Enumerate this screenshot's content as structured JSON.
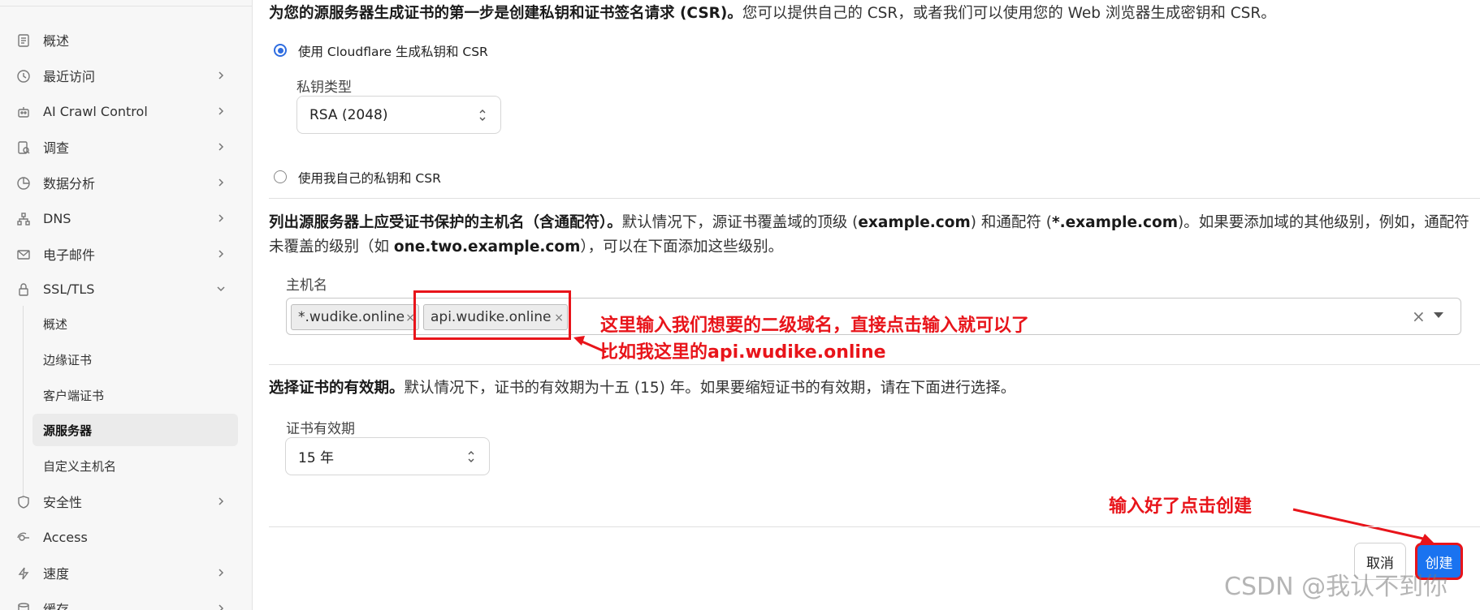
{
  "sidebar": {
    "items": [
      {
        "label": "概述",
        "icon": "document-icon",
        "chevron": false
      },
      {
        "label": "最近访问",
        "icon": "history-icon",
        "chevron": true
      },
      {
        "label": "AI Crawl Control",
        "icon": "robot-icon",
        "chevron": true
      },
      {
        "label": "调查",
        "icon": "investigate-icon",
        "chevron": true
      },
      {
        "label": "数据分析",
        "icon": "pie-chart-icon",
        "chevron": true
      },
      {
        "label": "DNS",
        "icon": "network-icon",
        "chevron": true
      },
      {
        "label": "电子邮件",
        "icon": "email-icon",
        "chevron": true
      },
      {
        "label": "SSL/TLS",
        "icon": "lock-icon",
        "chevron": "down"
      },
      {
        "label": "安全性",
        "icon": "shield-icon",
        "chevron": true
      },
      {
        "label": "Access",
        "icon": "access-icon",
        "chevron": false
      },
      {
        "label": "速度",
        "icon": "bolt-icon",
        "chevron": true
      },
      {
        "label": "缓存",
        "icon": "cache-icon",
        "chevron": true
      }
    ],
    "ssl_subitems": [
      {
        "label": "概述",
        "active": false
      },
      {
        "label": "边缘证书",
        "active": false
      },
      {
        "label": "客户端证书",
        "active": false
      },
      {
        "label": "源服务器",
        "active": true
      },
      {
        "label": "自定义主机名",
        "active": false
      }
    ]
  },
  "main": {
    "intro_bold": "为您的源服务器生成证书的第一步是创建私钥和证书签名请求 (CSR)。",
    "intro_rest": "您可以提供自己的 CSR，或者我们可以使用您的 Web 浏览器生成密钥和 CSR。",
    "option_generate": "使用 Cloudflare 生成私钥和 CSR",
    "key_type_label": "私钥类型",
    "key_type_value": "RSA (2048)",
    "option_own": "使用我自己的私钥和 CSR",
    "hosts_bold": "列出源服务器上应受证书保护的主机名（含通配符）。",
    "hosts_t1": "默认情况下，源证书覆盖域的顶级 (",
    "hosts_b1": "example.com",
    "hosts_t2": ") 和通配符 (",
    "hosts_b2": "*.example.com",
    "hosts_t3": ")。如果要添加域的其他级别，例如，通配符未覆盖的级别（如 ",
    "hosts_b3": "one.two.example.com",
    "hosts_t4": "），可以在下面添加这些级别。",
    "hostname_label": "主机名",
    "hostnames": [
      "*.wudike.online",
      "api.wudike.online"
    ],
    "validity_bold": "选择证书的有效期。",
    "validity_rest": "默认情况下，证书的有效期为十五 (15) 年。如果要缩短证书的有效期，请在下面进行选择。",
    "validity_label": "证书有效期",
    "validity_value": "15 年",
    "cancel_label": "取消",
    "create_label": "创建"
  },
  "annotations": {
    "hostname_note_1": "这里输入我们想要的二级域名，直接点击输入就可以了",
    "hostname_note_2": "比如我这里的api.wudike.online",
    "create_note": "输入好了点击创建",
    "color": "#e8141a"
  },
  "watermark": "CSDN @我认不到你",
  "colors": {
    "accent": "#2f6de0",
    "create_button": "#1a73f0"
  }
}
